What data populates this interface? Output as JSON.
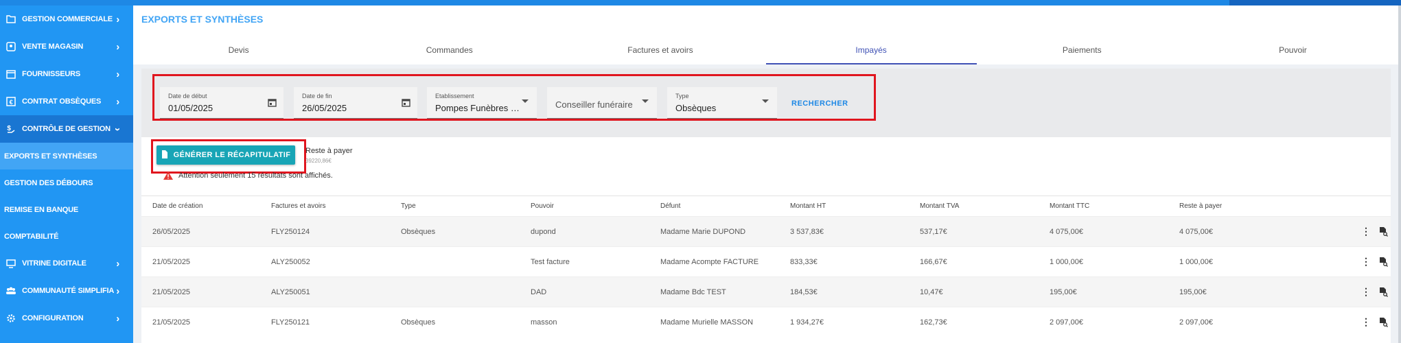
{
  "sidebar": {
    "items": [
      {
        "label": "GESTION COMMERCIALE",
        "icon": "folder-icon"
      },
      {
        "label": "VENTE MAGASIN",
        "icon": "user-icon"
      },
      {
        "label": "FOURNISSEURS",
        "icon": "box-icon"
      },
      {
        "label": "CONTRAT OBSÈQUES",
        "icon": "contract-icon"
      },
      {
        "label": "CONTRÔLE DE GESTION",
        "icon": "dollar-hand-icon"
      }
    ],
    "subitems": [
      {
        "label": "EXPORTS ET SYNTHÈSES"
      },
      {
        "label": "GESTION DES DÉBOURS"
      },
      {
        "label": "REMISE EN BANQUE"
      },
      {
        "label": "COMPTABILITÉ"
      }
    ],
    "items_bottom": [
      {
        "label": "VITRINE DIGITALE",
        "icon": "monitor-icon"
      },
      {
        "label": "COMMUNAUTÉ SIMPLIFIA",
        "icon": "community-icon"
      },
      {
        "label": "CONFIGURATION",
        "icon": "gear-icon"
      }
    ]
  },
  "page": {
    "title": "EXPORTS ET SYNTHÈSES"
  },
  "tabs": [
    "Devis",
    "Commandes",
    "Factures et avoirs",
    "Impayés",
    "Paiements",
    "Pouvoir"
  ],
  "active_tab": "Impayés",
  "filters": {
    "start_label": "Date de début",
    "start_value": "01/05/2025",
    "end_label": "Date de fin",
    "end_value": "26/05/2025",
    "etab_label": "Etablissement",
    "etab_value": "Pompes Funèbres M...",
    "conseiller_placeholder": "Conseiller funéraire",
    "type_label": "Type",
    "type_value": "Obsèques",
    "search_label": "RECHERCHER"
  },
  "summary": {
    "generate_label": "GÉNÉRER LE RÉCAPITULATIF",
    "reste_label": "Reste à payer",
    "reste_value": "39220,86€",
    "warning": "Attention seulement 15 résultats sont affichés."
  },
  "table": {
    "headers": [
      "Date de création",
      "Factures et avoirs",
      "Type",
      "Pouvoir",
      "Défunt",
      "Montant HT",
      "Montant TVA",
      "Montant TTC",
      "Reste à payer"
    ],
    "rows": [
      [
        "26/05/2025",
        "FLY250124",
        "Obsèques",
        "dupond",
        "Madame Marie DUPOND",
        "3 537,83€",
        "537,17€",
        "4 075,00€",
        "4 075,00€"
      ],
      [
        "21/05/2025",
        "ALY250052",
        "",
        "Test facture",
        "Madame Acompte FACTURE",
        "833,33€",
        "166,67€",
        "1 000,00€",
        "1 000,00€"
      ],
      [
        "21/05/2025",
        "ALY250051",
        "",
        "DAD",
        "Madame Bdc TEST",
        "184,53€",
        "10,47€",
        "195,00€",
        "195,00€"
      ],
      [
        "21/05/2025",
        "FLY250121",
        "Obsèques",
        "masson",
        "Madame Murielle MASSON",
        "1 934,27€",
        "162,73€",
        "2 097,00€",
        "2 097,00€"
      ]
    ]
  },
  "colors": {
    "sidebar": "#2196f3",
    "accent": "#42a5f5",
    "highlight": "#e0151e",
    "button": "#18a5b6"
  }
}
